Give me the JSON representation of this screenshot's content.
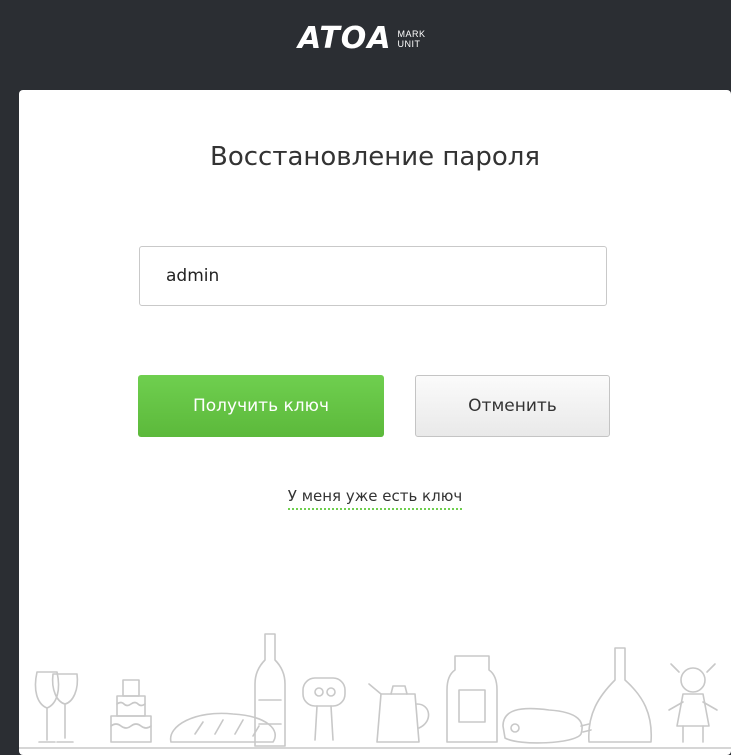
{
  "header": {
    "logo_text": "ATOA",
    "logo_sub_top": "MARK",
    "logo_sub_bottom": "UNIT"
  },
  "form": {
    "title": "Восстановление пароля",
    "username_value": "admin",
    "primary_button_label": "Получить ключ",
    "cancel_button_label": "Отменить",
    "have_key_link": "У меня уже есть ключ"
  },
  "colors": {
    "background": "#2b2e33",
    "card": "#ffffff",
    "accent_green": "#5cb93b"
  }
}
